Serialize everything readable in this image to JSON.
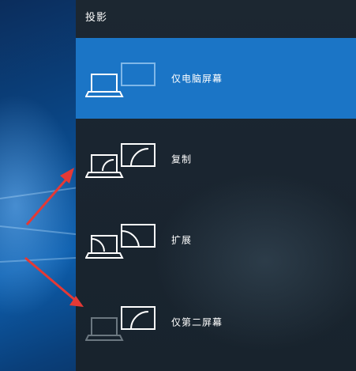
{
  "panel": {
    "title": "投影",
    "options": [
      {
        "label": "仅电脑屏幕",
        "icon": "pc-screen-only-icon",
        "selected": true
      },
      {
        "label": "复制",
        "icon": "duplicate-icon",
        "selected": false
      },
      {
        "label": "扩展",
        "icon": "extend-icon",
        "selected": false
      },
      {
        "label": "仅第二屏幕",
        "icon": "second-screen-only-icon",
        "selected": false
      }
    ]
  },
  "colors": {
    "selected": "#1b75c6",
    "panel": "#1a2530",
    "arrow": "#e53935"
  }
}
